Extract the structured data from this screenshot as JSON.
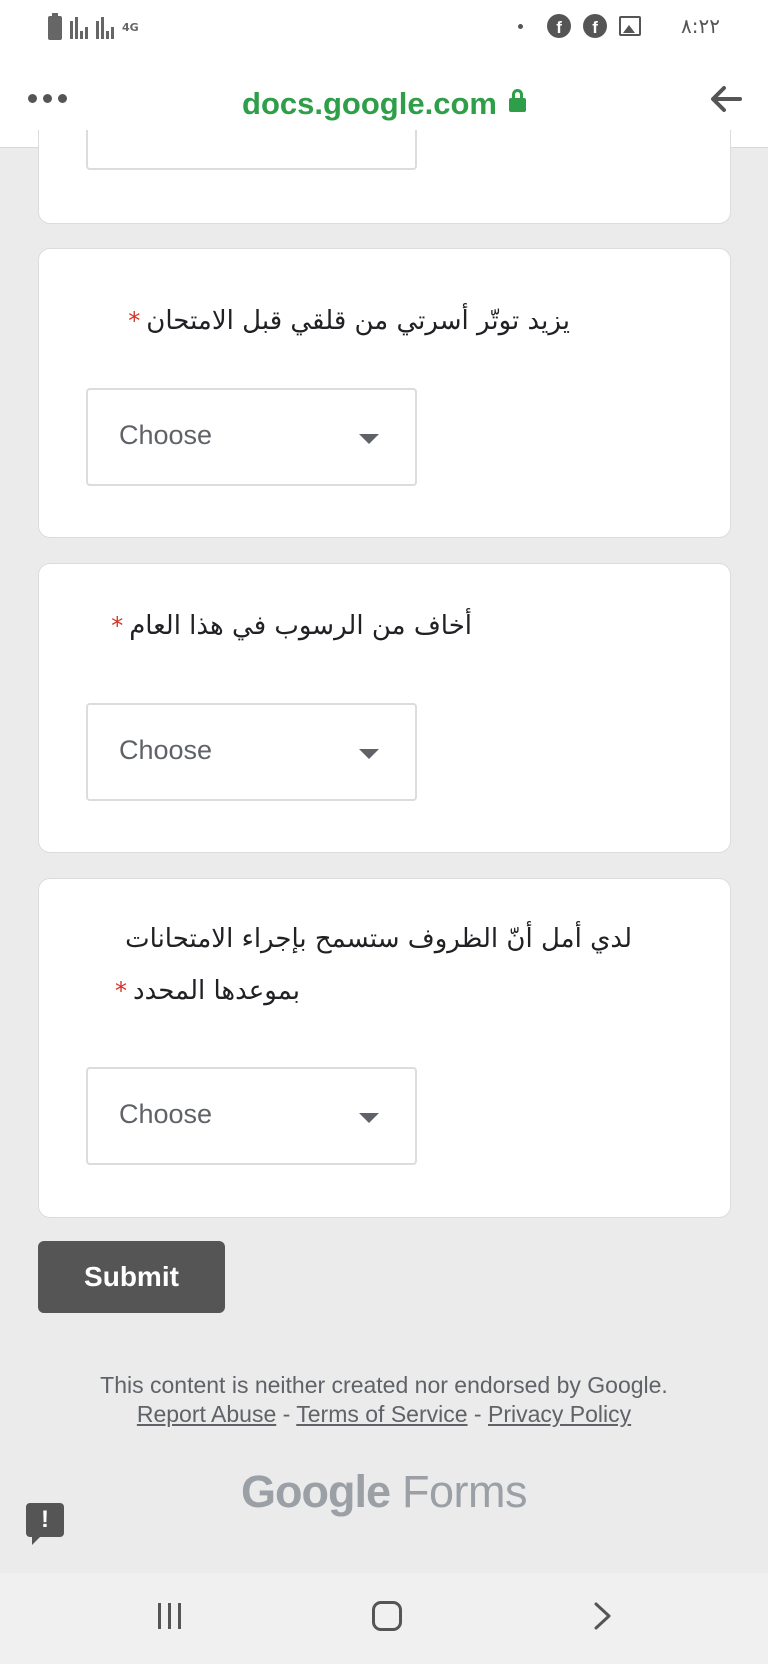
{
  "status_bar": {
    "network": "4G",
    "time": "٨:٢٢"
  },
  "address_bar": {
    "url": "docs.google.com"
  },
  "form": {
    "questions": [
      {
        "text": "يزيد توتّر أسرتي من قلقي قبل الامتحان",
        "select_placeholder": "Choose"
      },
      {
        "text": "أخاف من الرسوب في هذا العام",
        "select_placeholder": "Choose"
      },
      {
        "text_line1": "لدي أمل أنّ الظروف ستسمح بإجراء الامتحانات",
        "text_line2": "بموعدها المحدد",
        "select_placeholder": "Choose"
      }
    ],
    "required_mark": "*",
    "submit_label": "Submit"
  },
  "footer": {
    "disclaimer": "This content is neither created nor endorsed by Google.",
    "report_abuse": "Report Abuse",
    "separator": " - ",
    "terms": "Terms of Service",
    "privacy": "Privacy Policy",
    "brand_google": "Google",
    "brand_forms": "Forms",
    "feedback_icon_glyph": "!"
  },
  "colors": {
    "url_green": "#2e9e48",
    "required_red": "#d93025",
    "submit_bg": "#555555",
    "page_bg": "#ebebeb"
  },
  "icons": [
    "battery-icon",
    "signal-icon",
    "facebook-icon",
    "image-icon",
    "menu-dots-icon",
    "lock-icon",
    "back-arrow-icon",
    "dropdown-caret-icon",
    "feedback-icon",
    "recents-icon",
    "home-icon",
    "nav-back-icon"
  ]
}
